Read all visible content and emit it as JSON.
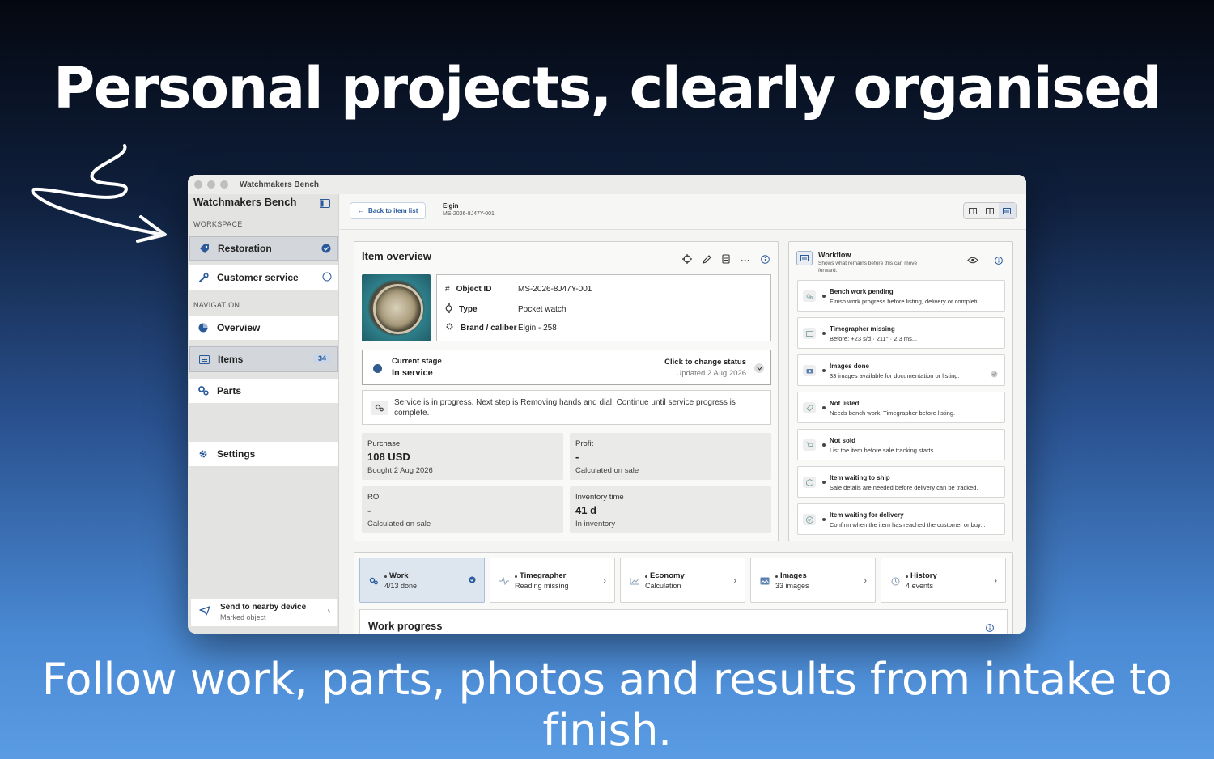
{
  "headline": "Personal projects, clearly organised",
  "subline": "Follow work, parts, photos and results from intake to finish.",
  "window": {
    "title": "Watchmakers Bench"
  },
  "sidebar": {
    "title": "Watchmakers Bench",
    "workspace_label": "WORKSPACE",
    "workspace_items": [
      {
        "label": "Restoration",
        "icon": "tag-icon",
        "selected": true
      },
      {
        "label": "Customer service",
        "icon": "wrench-icon",
        "selected": false
      }
    ],
    "navigation_label": "NAVIGATION",
    "nav_items": [
      {
        "label": "Overview",
        "icon": "pie-chart-icon"
      },
      {
        "label": "Items",
        "icon": "list-icon",
        "badge": "34"
      },
      {
        "label": "Parts",
        "icon": "gears-icon"
      }
    ],
    "settings_label": "Settings",
    "send": {
      "title": "Send to nearby device",
      "subtitle": "Marked object"
    }
  },
  "topbar": {
    "back_label": "Back to item list",
    "crumb_title": "Elgin",
    "crumb_id": "MS-2026-8J47Y-001"
  },
  "overview": {
    "title": "Item overview",
    "fields": [
      {
        "label": "Object ID",
        "value": "MS-2026-8J47Y-001",
        "icon": "hash-icon"
      },
      {
        "label": "Type",
        "value": "Pocket watch",
        "icon": "watch-icon"
      },
      {
        "label": "Brand / caliber",
        "value": "Elgin - 258",
        "icon": "gear-icon"
      }
    ],
    "stage": {
      "label": "Current stage",
      "value": "In service",
      "action": "Click to change status",
      "updated": "Updated 2 Aug 2026"
    },
    "note": "Service is in progress. Next step is Removing hands and dial. Continue until service progress is complete.",
    "metrics": [
      {
        "label": "Purchase",
        "value": "108 USD",
        "sub": "Bought 2 Aug 2026"
      },
      {
        "label": "Profit",
        "value": "-",
        "sub": "Calculated on sale"
      },
      {
        "label": "ROI",
        "value": "-",
        "sub": "Calculated on sale"
      },
      {
        "label": "Inventory time",
        "value": "41 d",
        "sub": "In inventory"
      }
    ]
  },
  "workflow": {
    "title": "Workflow",
    "subtitle": "Shows what remains before this can move forward.",
    "items": [
      {
        "title": "Bench work pending",
        "desc": "Finish work progress before listing, delivery or completi...",
        "icon": "gears-icon"
      },
      {
        "title": "Timegrapher missing",
        "desc": "Before: +23 s/d · 211° · 2,3 ms...",
        "icon": "image-icon"
      },
      {
        "title": "Images done",
        "desc": "33 images available for documentation or listing.",
        "icon": "camera-icon",
        "done": true
      },
      {
        "title": "Not listed",
        "desc": "Needs bench work, Timegrapher before listing.",
        "icon": "tag-icon"
      },
      {
        "title": "Not sold",
        "desc": "List the item before sale tracking starts.",
        "icon": "cart-icon"
      },
      {
        "title": "Item waiting to ship",
        "desc": "Sale details are needed before delivery can be tracked.",
        "icon": "box-icon"
      },
      {
        "title": "Item waiting for delivery",
        "desc": "Confirm when the item has reached the customer or buy...",
        "icon": "check-circle-icon"
      }
    ]
  },
  "tabs": [
    {
      "title": "Work",
      "sub": "4/13 done",
      "icon": "gears-icon",
      "active": true
    },
    {
      "title": "Timegrapher",
      "sub": "Reading missing",
      "icon": "pulse-icon"
    },
    {
      "title": "Economy",
      "sub": "Calculation",
      "icon": "chart-icon"
    },
    {
      "title": "Images",
      "sub": "33 images",
      "icon": "image-icon"
    },
    {
      "title": "History",
      "sub": "4 events",
      "icon": "clock-icon"
    }
  ],
  "work_progress": {
    "title": "Work progress"
  },
  "colors": {
    "accent": "#2a5a9a",
    "stage_dot": "#2f5d8e"
  }
}
